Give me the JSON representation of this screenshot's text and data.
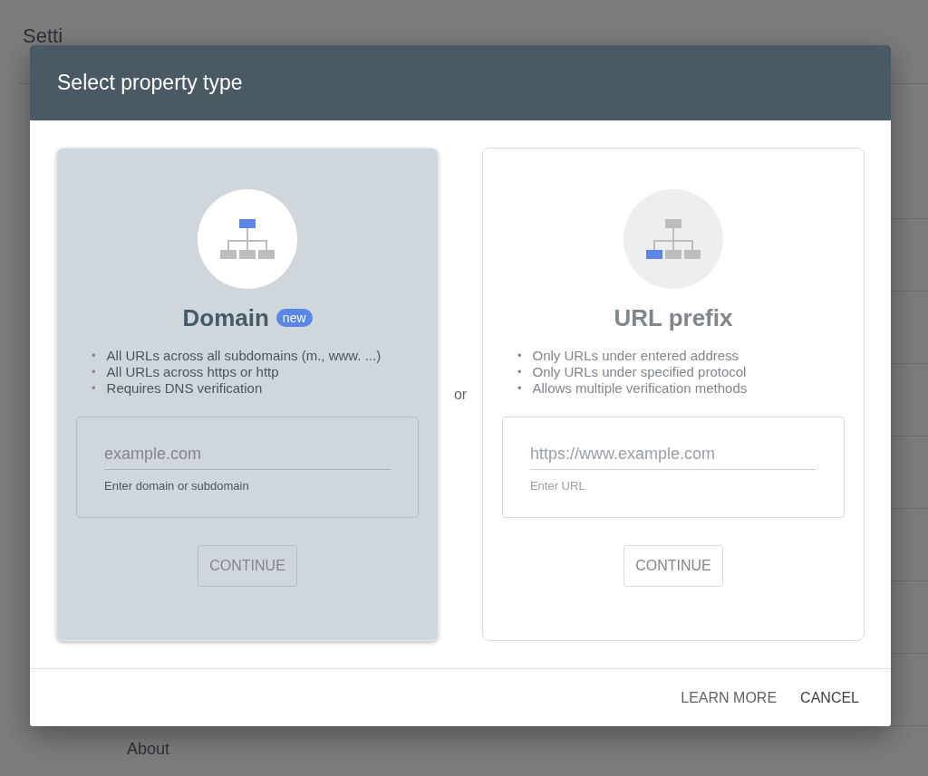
{
  "background": {
    "title": "Setti",
    "footer_link": "About"
  },
  "dialog": {
    "title": "Select property type",
    "separator": "or",
    "options": [
      {
        "kind": "domain",
        "title": "Domain",
        "badge": "new",
        "selected": true,
        "bullets": [
          {
            "marker": "•",
            "text": "All URLs across all subdomains (m., www. ...)"
          },
          {
            "marker": "•",
            "text": "All URLs across https or http"
          },
          {
            "marker": "•",
            "text": "Requires DNS verification"
          }
        ],
        "placeholder": "example.com",
        "hint": "Enter domain or subdomain",
        "button": "CONTINUE"
      },
      {
        "kind": "prefix",
        "title": "URL prefix",
        "selected": false,
        "bullets": [
          {
            "marker": "•",
            "text": "Only URLs under entered address"
          },
          {
            "marker": "•",
            "text": "Only URLs under specified protocol"
          },
          {
            "marker": "•",
            "text": "Allows multiple verification methods"
          }
        ],
        "placeholder": "https://www.example.com",
        "hint": "Enter URL",
        "button": "CONTINUE"
      }
    ],
    "actions": [
      "LEARN MORE",
      "CANCEL"
    ]
  }
}
